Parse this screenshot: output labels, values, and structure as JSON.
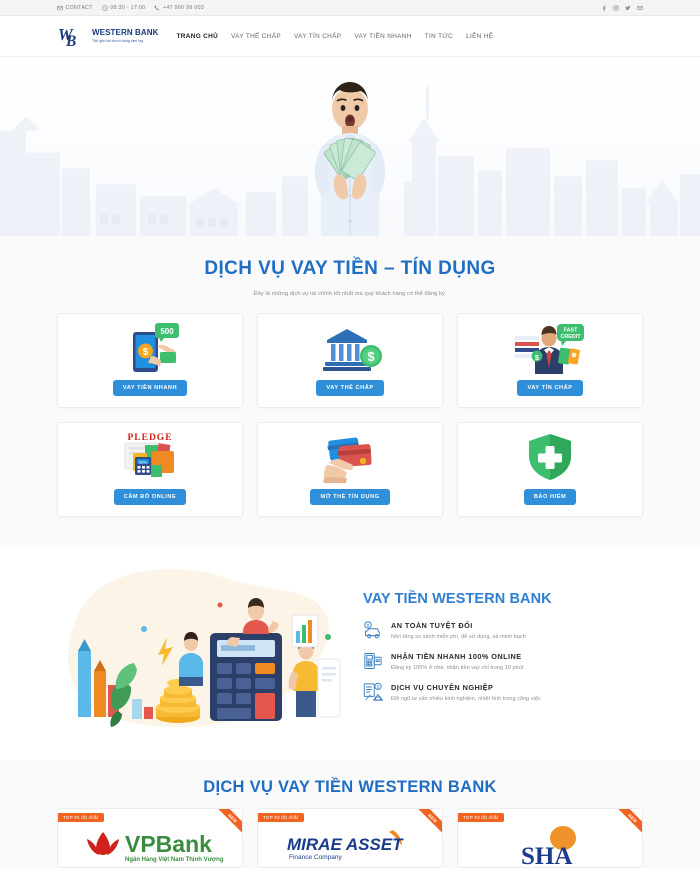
{
  "topbar": {
    "contact_label": "CONTACT",
    "hours": "08:30 - 17:00",
    "phone": "+47 900 99 003",
    "social": [
      "facebook-icon",
      "instagram-icon",
      "twitter-icon",
      "mail-icon"
    ]
  },
  "header": {
    "logo_title": "WESTERN BANK",
    "logo_tagline": "Thế giới tài chính trong tầm tay",
    "logo_mark": "WB",
    "nav": [
      {
        "label": "TRANG CHỦ",
        "active": true
      },
      {
        "label": "VAY THẾ CHẤP",
        "active": false
      },
      {
        "label": "VAY TÍN CHẤP",
        "active": false
      },
      {
        "label": "VAY TIỀN NHANH",
        "active": false
      },
      {
        "label": "TIN TỨC",
        "active": false
      },
      {
        "label": "LIÊN HỆ",
        "active": false
      }
    ]
  },
  "hero": {
    "alt": "man-holding-cash-photo",
    "background": "city-skyline-silhouette"
  },
  "services": {
    "title": "DỊCH VỤ VAY TIỀN – TÍN DỤNG",
    "subtitle": "Đây là những dịch vụ tài chính tốt nhất mà quý khách hàng có thể đăng ký.",
    "cards": [
      {
        "button": "VAY TIỀN NHANH",
        "icon": "phone-money-icon",
        "badge": "500"
      },
      {
        "button": "VAY THẾ CHẤP",
        "icon": "bank-dollar-icon",
        "badge": ""
      },
      {
        "button": "VAY TÍN CHẤP",
        "icon": "fast-credit-man-icon",
        "badge": "FAST CREDIT"
      },
      {
        "button": "CẦM ĐỒ ONLINE",
        "icon": "pledge-folder-icon",
        "badge": "PLEDGE"
      },
      {
        "button": "MỞ THẺ TÍN DỤNG",
        "icon": "hand-credit-card-icon",
        "badge": ""
      },
      {
        "button": "BẢO HIỂM",
        "icon": "shield-cross-icon",
        "badge": ""
      }
    ]
  },
  "features": {
    "title": "VAY TIỀN WESTERN BANK",
    "illustration": "finance-calculator-illustration",
    "items": [
      {
        "icon": "secure-car-icon",
        "heading": "AN TOÀN TUYỆT ĐỐI",
        "text": "Nền tảng so sánh miễn phí, dễ sử dụng, và minh bạch"
      },
      {
        "icon": "atm-machine-icon",
        "heading": "NHẬN TIỀN NHANH 100% ONLINE",
        "text": "Đăng ký 100% ở nhà, nhận tiền vay chỉ trong 10 phút"
      },
      {
        "icon": "document-house-icon",
        "heading": "DỊCH VỤ CHUYÊN NGHIỆP",
        "text": "Đội ngũ tư vấn nhiều kinh nghiệm, nhiệt tình trong công việc"
      }
    ]
  },
  "banks": {
    "title": "DỊCH VỤ VAY TIỀN WESTERN BANK",
    "cards": [
      {
        "tag": "TOP #1 tốt nhất",
        "ribbon": "NEW",
        "name": "VPBank",
        "sub": "Ngân hàng Việt Nam Thịnh Vượng",
        "logo": "vpbank-logo"
      },
      {
        "tag": "TOP #2 tốt nhất",
        "ribbon": "NEW",
        "name": "MIRAE ASSET",
        "sub": "",
        "logo": "mirae-asset-logo"
      },
      {
        "tag": "TOP #3 tốt nhất",
        "ribbon": "NEW",
        "name": "SHA",
        "sub": "",
        "logo": "sha-logo"
      }
    ]
  },
  "colors": {
    "accent_blue": "#2f8fd8",
    "heading_blue": "#1f6ec4",
    "logo_navy": "#1a3a7a",
    "orange": "#ef6421",
    "page_bg": "#fafafa"
  }
}
